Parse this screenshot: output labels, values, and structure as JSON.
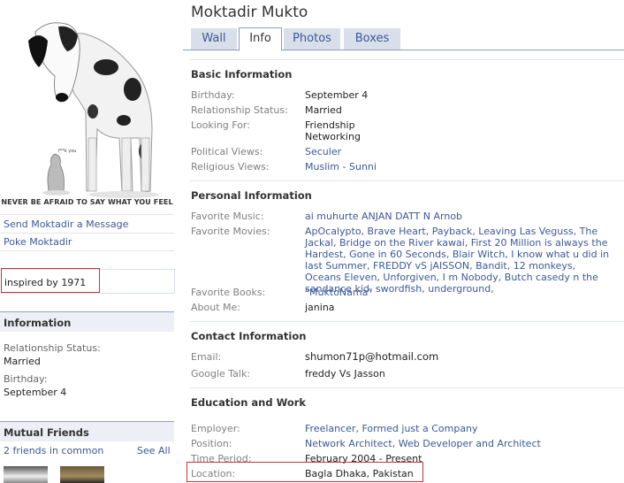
{
  "profile": {
    "name": "Moktadir Mukto"
  },
  "tabs": [
    {
      "label": "Wall"
    },
    {
      "label": "Info"
    },
    {
      "label": "Photos"
    },
    {
      "label": "Boxes"
    }
  ],
  "sidebar": {
    "motto": "NEVER BE AFRAID TO SAY WHAT YOU FEEL",
    "pic_caption": "f**k you",
    "send_message": "Send Moktadir a Message",
    "poke": "Poke Moktadir",
    "status": "inspired by 1971",
    "information": {
      "title": "Information",
      "relationship_label": "Relationship Status:",
      "relationship_value": "Married",
      "birthday_label": "Birthday:",
      "birthday_value": "September 4"
    },
    "mutual_friends": {
      "title": "Mutual Friends",
      "count_link": "2 friends in common",
      "see_all": "See All"
    }
  },
  "basic": {
    "title": "Basic Information",
    "birthday_label": "Birthday:",
    "birthday": "September 4",
    "relationship_label": "Relationship Status:",
    "relationship": "Married",
    "looking_label": "Looking For:",
    "looking_1": "Friendship",
    "looking_2": "Networking",
    "political_label": "Political Views:",
    "political": "Seculer",
    "religious_label": "Religious Views:",
    "religious": "Muslim - Sunni"
  },
  "personal": {
    "title": "Personal Information",
    "music_label": "Favorite Music:",
    "music": "ai muhurte ANJAN DATT N Arnob",
    "movies_label": "Favorite Movies:",
    "movies": "ApOcalypto, Brave Heart, Payback, Leaving Las Veguss, The Jackal, Bridge on the River kawai, First 20 Million is always the Hardest, Gone in 60 Seconds, Blair Witch, I know what u did in last Summer, FREDDY vS jAISSON, Bandit, 12 monkeys, Oceans Eleven, Unforgiven, I m Nobody, Butch casedy n the sandance kid, swordfish, underground,",
    "books_label": "Favorite Books:",
    "books": "\"MuktoNama\"",
    "about_label": "About Me:",
    "about": "janina"
  },
  "contact": {
    "title": "Contact Information",
    "email_label": "Email:",
    "email": "shumon71p@hotmail.com",
    "gtalk_label": "Google Talk:",
    "gtalk": "freddy Vs Jasson"
  },
  "education": {
    "title": "Education and Work",
    "employer_label": "Employer:",
    "employer": "Freelancer, Formed just a Company",
    "position_label": "Position:",
    "position": "Network Architect, Web Developer and Architect",
    "period_label": "Time Period:",
    "period": "February 2004 - Present",
    "location_label": "Location:",
    "location": "Bagla Dhaka, Pakistan"
  },
  "colors": {
    "link": "#3b5998",
    "tab_bg": "#d8dfea",
    "highlight": "#c8343a"
  }
}
